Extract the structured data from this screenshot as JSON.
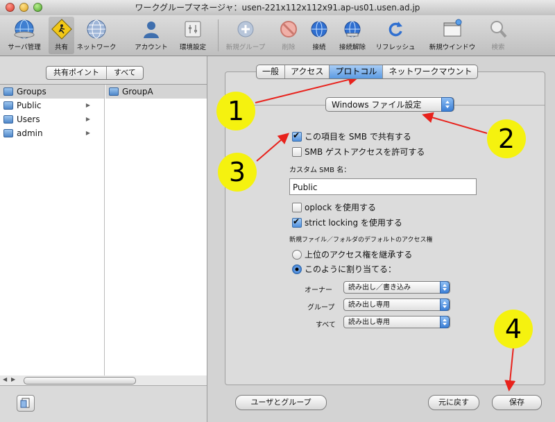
{
  "window": {
    "title": "ワークグループマネージャ：usen-221x112x112x91.ap-us01.usen.ad.jp"
  },
  "toolbar": {
    "items": [
      {
        "label": "サーバ管理",
        "icon": "globe-icon"
      },
      {
        "label": "共有",
        "icon": "sharing-icon",
        "selected": true
      },
      {
        "label": "ネットワーク",
        "icon": "network-globe-icon"
      },
      {
        "label": "アカウント",
        "icon": "account-icon"
      },
      {
        "label": "環境設定",
        "icon": "preferences-icon"
      },
      {
        "label": "新規グループ",
        "icon": "plus-icon",
        "disabled": true
      },
      {
        "label": "削除",
        "icon": "delete-icon",
        "disabled": true
      },
      {
        "label": "接続",
        "icon": "connect-icon"
      },
      {
        "label": "接続解除",
        "icon": "disconnect-icon"
      },
      {
        "label": "リフレッシュ",
        "icon": "refresh-icon"
      },
      {
        "label": "新規ウインドウ",
        "icon": "new-window-icon"
      },
      {
        "label": "検索",
        "icon": "search-icon",
        "disabled": true
      }
    ]
  },
  "left": {
    "segments": [
      "共有ポイント",
      "すべて"
    ],
    "column1": [
      {
        "label": "Groups",
        "selected": true,
        "arrow": false
      },
      {
        "label": "Public",
        "arrow": true
      },
      {
        "label": "Users",
        "arrow": true
      },
      {
        "label": "admin",
        "arrow": true
      }
    ],
    "column2": [
      {
        "label": "GroupA",
        "selected": true
      }
    ]
  },
  "right": {
    "tabs": [
      "一般",
      "アクセス",
      "プロトコル",
      "ネットワークマウント"
    ],
    "active_tab": "プロトコル",
    "protocol_popup": "Windows ファイル設定",
    "share_smb": {
      "label": "この項目を SMB で共有する",
      "checked": true
    },
    "guest_access": {
      "label": "SMB ゲストアクセスを許可する",
      "checked": false
    },
    "custom_name_label": "カスタム SMB 名：",
    "custom_name_value": "Public",
    "oplock": {
      "label": "oplock を使用する",
      "checked": false
    },
    "strict_locking": {
      "label": "strict locking を使用する",
      "checked": true
    },
    "default_access_label": "新規ファイル／フォルダのデフォルトのアクセス権",
    "inherit": {
      "label": "上位のアクセス権を継承する",
      "selected": false
    },
    "assign": {
      "label": "このように割り当てる：",
      "selected": true
    },
    "permissions": [
      {
        "label": "オーナー",
        "value": "読み出し／書き込み"
      },
      {
        "label": "グループ",
        "value": "読み出し専用"
      },
      {
        "label": "すべて",
        "value": "読み出し専用"
      }
    ],
    "buttons": {
      "users_groups": "ユーザとグループ",
      "revert": "元に戻す",
      "save": "保存"
    }
  },
  "callouts": [
    "1",
    "2",
    "3",
    "4"
  ],
  "colors": {
    "callout": "#f5f20f",
    "arrow": "#e8221c",
    "selection": "#5b9ae3"
  }
}
